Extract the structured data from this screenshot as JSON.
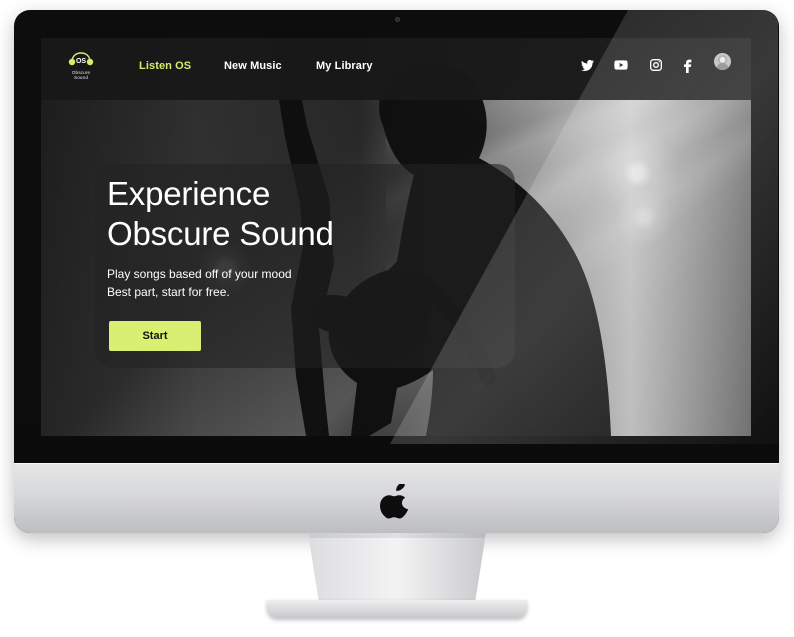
{
  "device": {
    "name": "iMac",
    "colors": {
      "bezel": "#0d0d0d",
      "chin": "#d7d8da",
      "accent": "#d9ef72"
    }
  },
  "nav": {
    "brand_top": "OS",
    "brand_sub": "Obscure\nSound",
    "items": [
      {
        "label": "Listen OS",
        "active": true
      },
      {
        "label": "New Music",
        "active": false
      },
      {
        "label": "My Library",
        "active": false
      }
    ],
    "social_icons": [
      "twitter-icon",
      "youtube-icon",
      "instagram-icon",
      "facebook-icon",
      "avatar"
    ]
  },
  "hero": {
    "headline": "Experience Obscure Sound",
    "subtitle_line_1": "Play songs based off of your mood",
    "subtitle_line_2": "Best part, start for free.",
    "button_label": "Start"
  }
}
